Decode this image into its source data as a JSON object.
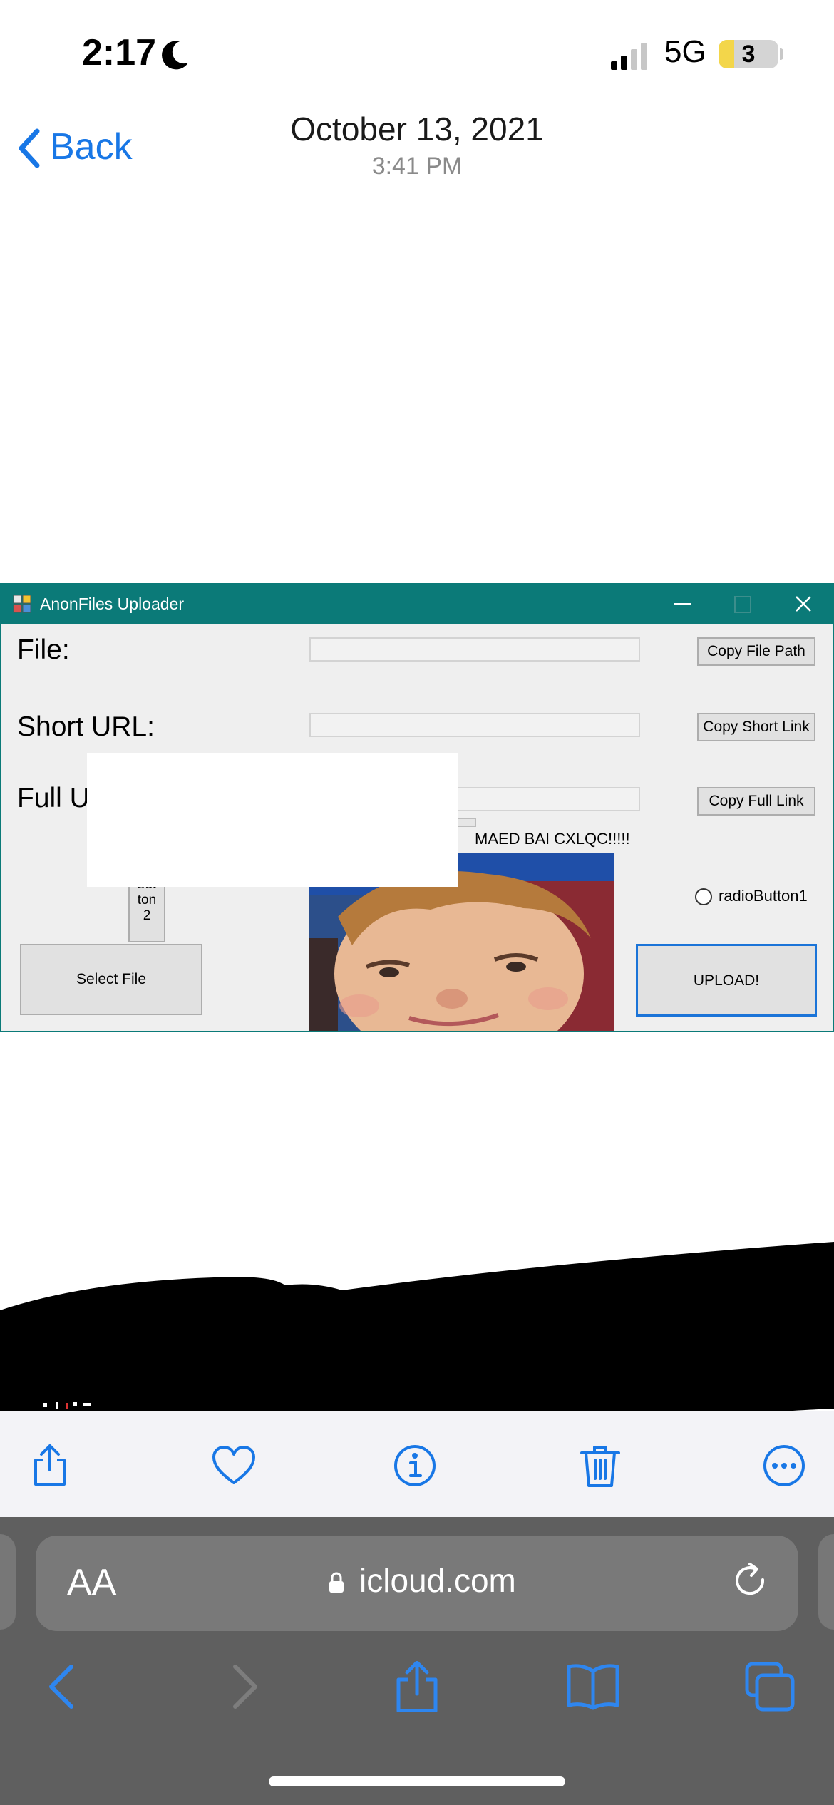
{
  "status_bar": {
    "time": "2:17",
    "network": "5G",
    "battery": "3",
    "icons": [
      "moon-icon",
      "signal-icon",
      "battery-icon"
    ]
  },
  "photo_header": {
    "back_label": "Back",
    "date": "October 13, 2021",
    "time": "3:41 PM"
  },
  "app_window": {
    "title": "AnonFiles Uploader",
    "title_bar_color": "#0b7a78",
    "labels": {
      "file": "File:",
      "short_url": "Short URL:",
      "full_url": "Full U"
    },
    "fields": {
      "file_path": "",
      "short_url": "",
      "full_url": ""
    },
    "buttons": {
      "copy_file_path": "Copy File Path",
      "copy_short_link": "Copy Short Link",
      "copy_full_link": "Copy Full Link",
      "button2_lines": [
        "but",
        "ton",
        "2"
      ],
      "select_file": "Select File",
      "upload": "UPLOAD!"
    },
    "caption": "MAED BAI CXLQC!!!!!",
    "radio_label": "radioButton1"
  },
  "photos_toolbar": {
    "icons": [
      "share-icon",
      "heart-icon",
      "info-icon",
      "trash-icon",
      "more-icon"
    ]
  },
  "safari": {
    "aa_label": "AA",
    "url": "icloud.com",
    "accent": "#1877e6",
    "icons": [
      "lock-icon",
      "reload-icon",
      "back-icon",
      "forward-icon",
      "share-icon",
      "bookmarks-icon",
      "tabs-icon"
    ]
  }
}
